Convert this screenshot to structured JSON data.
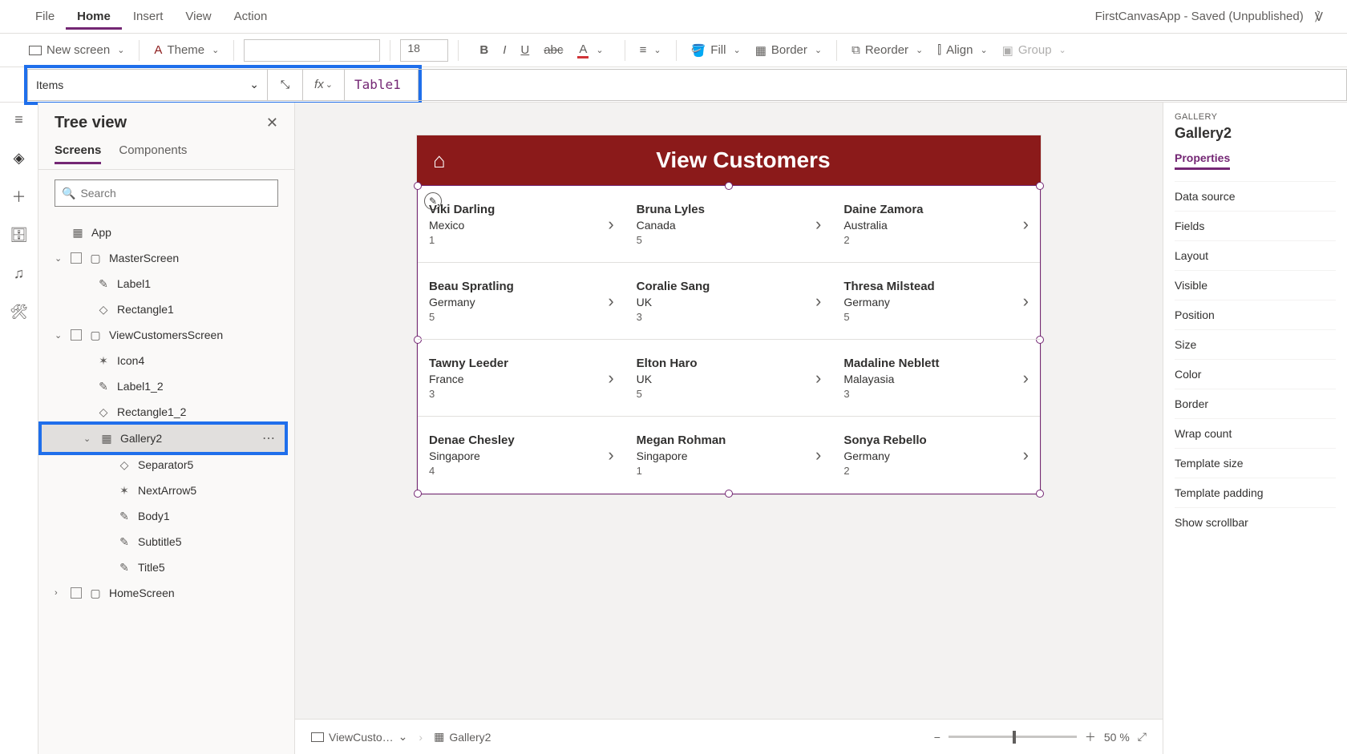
{
  "menubar": {
    "items": [
      "File",
      "Home",
      "Insert",
      "View",
      "Action"
    ],
    "activeIndex": 1,
    "docTitle": "FirstCanvasApp - Saved (Unpublished)"
  },
  "toolbar": {
    "newScreen": "New screen",
    "theme": "Theme",
    "fontSize": "18",
    "fill": "Fill",
    "border": "Border",
    "reorder": "Reorder",
    "align": "Align",
    "group": "Group"
  },
  "formulaBar": {
    "property": "Items",
    "fx": "fx",
    "value": "Table1"
  },
  "treeView": {
    "title": "Tree view",
    "tabs": [
      "Screens",
      "Components"
    ],
    "activeTab": 0,
    "searchPlaceholder": "Search",
    "items": [
      {
        "label": "App",
        "icon": "▦",
        "depth": 0
      },
      {
        "label": "MasterScreen",
        "icon": "▢",
        "depth": 0,
        "chevron": "⌄",
        "checkbox": true
      },
      {
        "label": "Label1",
        "icon": "✎",
        "depth": 1
      },
      {
        "label": "Rectangle1",
        "icon": "◇",
        "depth": 1
      },
      {
        "label": "ViewCustomersScreen",
        "icon": "▢",
        "depth": 0,
        "chevron": "⌄",
        "checkbox": true
      },
      {
        "label": "Icon4",
        "icon": "✶",
        "depth": 1
      },
      {
        "label": "Label1_2",
        "icon": "✎",
        "depth": 1
      },
      {
        "label": "Rectangle1_2",
        "icon": "◇",
        "depth": 1
      },
      {
        "label": "Gallery2",
        "icon": "▦",
        "depth": 1,
        "chevron": "⌄",
        "selected": true,
        "dots": true
      },
      {
        "label": "Separator5",
        "icon": "◇",
        "depth": 2
      },
      {
        "label": "NextArrow5",
        "icon": "✶",
        "depth": 2
      },
      {
        "label": "Body1",
        "icon": "✎",
        "depth": 2
      },
      {
        "label": "Subtitle5",
        "icon": "✎",
        "depth": 2
      },
      {
        "label": "Title5",
        "icon": "✎",
        "depth": 2
      },
      {
        "label": "HomeScreen",
        "icon": "▢",
        "depth": 0,
        "chevron": "›",
        "checkbox": true
      }
    ]
  },
  "preview": {
    "headerTitle": "View Customers",
    "customers": [
      {
        "name": "Viki  Darling",
        "country": "Mexico",
        "num": "1"
      },
      {
        "name": "Bruna  Lyles",
        "country": "Canada",
        "num": "5"
      },
      {
        "name": "Daine  Zamora",
        "country": "Australia",
        "num": "2"
      },
      {
        "name": "Beau  Spratling",
        "country": "Germany",
        "num": "5"
      },
      {
        "name": "Coralie  Sang",
        "country": "UK",
        "num": "3"
      },
      {
        "name": "Thresa  Milstead",
        "country": "Germany",
        "num": "5"
      },
      {
        "name": "Tawny  Leeder",
        "country": "France",
        "num": "3"
      },
      {
        "name": "Elton  Haro",
        "country": "UK",
        "num": "5"
      },
      {
        "name": "Madaline  Neblett",
        "country": "Malayasia",
        "num": "3"
      },
      {
        "name": "Denae  Chesley",
        "country": "Singapore",
        "num": "4"
      },
      {
        "name": "Megan  Rohman",
        "country": "Singapore",
        "num": "1"
      },
      {
        "name": "Sonya  Rebello",
        "country": "Germany",
        "num": "2"
      }
    ]
  },
  "breadcrumb": {
    "screen": "ViewCusto…",
    "control": "Gallery2"
  },
  "zoom": {
    "value": "50",
    "unit": "%"
  },
  "propsPanel": {
    "typeLabel": "GALLERY",
    "name": "Gallery2",
    "tab": "Properties",
    "rows": [
      "Data source",
      "Fields",
      "Layout",
      "Visible",
      "Position",
      "Size",
      "Color",
      "Border",
      "Wrap count",
      "Template size",
      "Template padding",
      "Show scrollbar"
    ]
  }
}
